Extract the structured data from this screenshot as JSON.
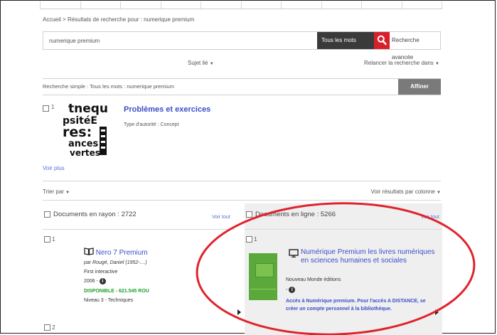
{
  "breadcrumb": {
    "home": "Accueil",
    "separator": ">",
    "current": "Résultats de recherche pour : numerique premium"
  },
  "search": {
    "value": "numerique premium",
    "mode": "Tous les mots",
    "advanced_label": "Recherche avancée"
  },
  "filters": {
    "subject_label": "Sujet lié",
    "relaunch_label": "Relancer la recherche dans",
    "simple_search_text": "Recherche simple :   Tous les mots : numerique premium",
    "refine_label": "Affiner"
  },
  "authority": {
    "number": "1",
    "title": "Problèmes et exercices",
    "type_text": "Type d'autorité : Concept",
    "cover_words": [
      "tnequ",
      "psitéE",
      "res:",
      "ances",
      "vertes"
    ]
  },
  "see_more_label": "Voir plus",
  "sort": {
    "sort_label": "Trier par",
    "results_col_label": "Voir résultats par colonne"
  },
  "columns": {
    "left": {
      "heading": "Documents en rayon : 2722",
      "see_all": "Voir tout",
      "items": [
        {
          "number": "1",
          "title": "Nero 7 Premium",
          "author": "par Rougé, Daniel (1952-....)",
          "publisher": "First interactive",
          "year": "2006 -",
          "availability": "DISPONIBLE",
          "call_number": " - 621.545 ROU",
          "level": "Niveau 3 - Techniques"
        },
        {
          "number": "2"
        }
      ]
    },
    "right": {
      "heading": "Documents en ligne : 5266",
      "see_all": "Voir tout",
      "items": [
        {
          "number": "1",
          "title": "Numérique Premium les livres numériques en sciences humaines et sociales",
          "publisher": "Nouveau Monde éditions",
          "year": "-",
          "access_note": "Accès à Numérique premium. Pour l'accès A DISTANCE, se créer un compte personnel à la bibliothèque."
        }
      ]
    }
  },
  "colors": {
    "link": "#3b4fc9",
    "search_go": "#d8202c",
    "dark_bar": "#3a3a3a",
    "refine": "#7a7a7a",
    "available": "#1d9f2a",
    "highlight": "#e0232c",
    "green_cover": "#5ba93a"
  },
  "icons": {
    "search": "search-icon",
    "caret": "caret-down-icon",
    "book": "book-icon",
    "monitor": "monitor-icon",
    "info": "info-icon"
  }
}
